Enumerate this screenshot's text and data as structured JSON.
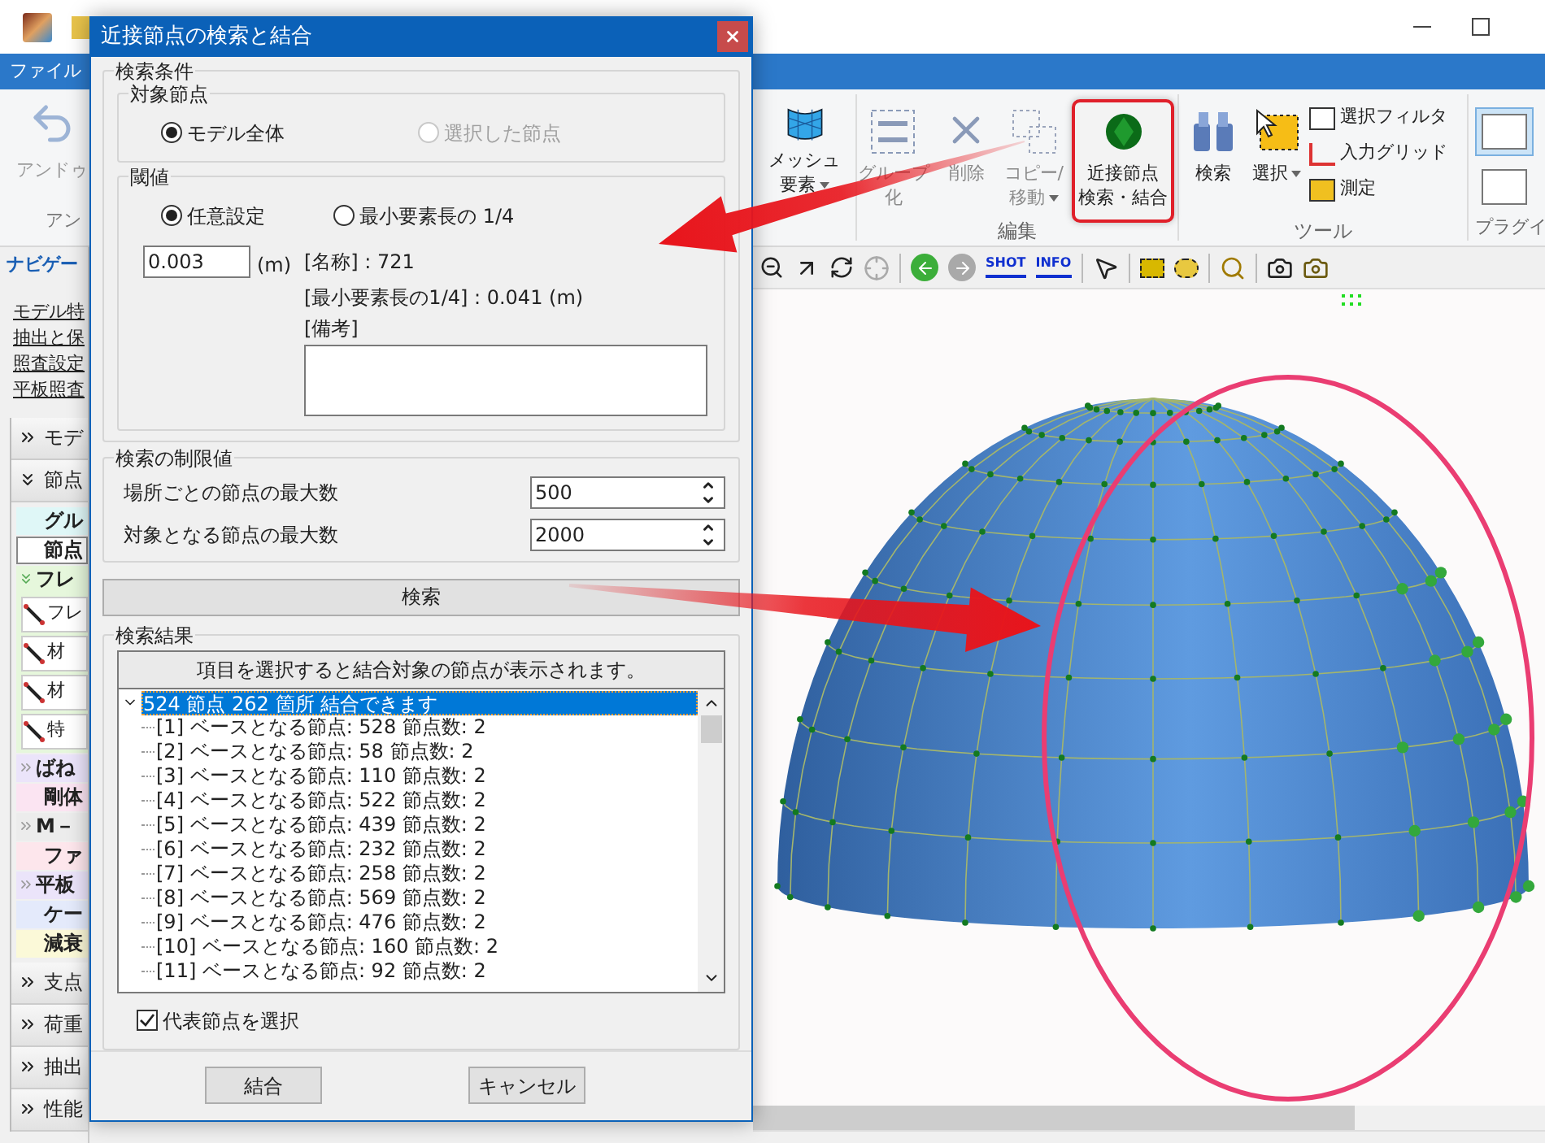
{
  "menu_tab": "ファイル",
  "ribbon": {
    "undo": {
      "label": "アンドゥ",
      "disabled": true
    },
    "undo_group": "アン",
    "mesh": {
      "lines": [
        "メッシュ",
        "要素"
      ],
      "dropdown": true,
      "disabled": false
    },
    "edit_group": {
      "label": "編集",
      "buttons": [
        {
          "lines": [
            "グループ",
            "化"
          ],
          "dropdown": false,
          "disabled": true,
          "highlighted": false
        },
        {
          "lines": [
            "削除"
          ],
          "dropdown": false,
          "disabled": true,
          "highlighted": false
        },
        {
          "lines": [
            "コピー/",
            "移動"
          ],
          "dropdown": true,
          "disabled": true,
          "highlighted": false
        },
        {
          "lines": [
            "近接節点",
            "検索・結合"
          ],
          "dropdown": false,
          "disabled": false,
          "highlighted": true
        }
      ]
    },
    "tool_group": {
      "label": "ツール",
      "buttons": [
        {
          "lines": [
            "検索"
          ],
          "dropdown": false
        },
        {
          "lines": [
            "選択"
          ],
          "dropdown": true
        }
      ],
      "small": [
        "選択フィルタ",
        "入力グリッド",
        "測定"
      ]
    },
    "plugin_group": {
      "label": "プラグイ",
      "thumbs": [
        {
          "selected": true
        },
        {
          "selected": false
        }
      ]
    }
  },
  "toolbar": {
    "shot": "SHOT",
    "info": "INFO"
  },
  "navigator": {
    "title": "ナビゲー",
    "links": [
      "モデル特",
      "抽出と保",
      "照査設定",
      "平板照査"
    ],
    "sections": [
      {
        "label": "モデ",
        "expanded": false
      },
      {
        "label": "節点",
        "expanded": true,
        "items": [
          {
            "label": "グル",
            "kind": "item",
            "color": "#dff7f7",
            "selected": false
          },
          {
            "label": "節点",
            "kind": "item",
            "color": "#ffffff",
            "selected": true
          },
          {
            "label": "フレ",
            "kind": "group",
            "color": "#e6f7dc",
            "selected": false,
            "expanded": true,
            "children": [
              {
                "label": "フレ",
                "selected": false
              },
              {
                "label": "材",
                "selected": false
              },
              {
                "label": "材",
                "selected": false
              },
              {
                "label": "特",
                "selected": false
              }
            ]
          },
          {
            "label": "ばね",
            "kind": "group",
            "color": "#ebe4fa",
            "selected": false,
            "expanded": false
          },
          {
            "label": "剛体",
            "kind": "item",
            "color": "#fbe4f2",
            "selected": false
          },
          {
            "label": "M－",
            "kind": "group",
            "color": "#ececec",
            "selected": false,
            "expanded": false
          },
          {
            "label": "ファ",
            "kind": "item",
            "color": "#fde6ec",
            "selected": false
          },
          {
            "label": "平板",
            "kind": "group",
            "color": "#ebe4fa",
            "selected": false,
            "expanded": false
          },
          {
            "label": "ケー",
            "kind": "item",
            "color": "#e4eafb",
            "selected": false
          },
          {
            "label": "減衰",
            "kind": "item",
            "color": "#fbf9d8",
            "selected": false
          }
        ]
      },
      {
        "label": "支点",
        "expanded": false
      },
      {
        "label": "荷重",
        "expanded": false
      },
      {
        "label": "抽出",
        "expanded": false
      },
      {
        "label": "性能",
        "expanded": false
      }
    ]
  },
  "dialog": {
    "title": "近接節点の検索と結合",
    "conditions": {
      "title": "検索条件",
      "target": {
        "title": "対象節点",
        "options": [
          {
            "label": "モデル全体",
            "selected": true,
            "disabled": false
          },
          {
            "label": "選択した節点",
            "selected": false,
            "disabled": true
          }
        ]
      },
      "threshold": {
        "title": "閾値",
        "options": [
          {
            "label": "任意設定",
            "selected": true
          },
          {
            "label": "最小要素長の 1/4",
            "selected": false
          }
        ],
        "value": "0.003",
        "unit": "(m)",
        "name": "[名称] : 721",
        "quarter": "[最小要素長の1/4] : 0.041 (m)",
        "note_label": "[備考]"
      }
    },
    "limits": {
      "title": "検索の制限値",
      "rows": [
        {
          "label": "場所ごとの節点の最大数",
          "value": "500"
        },
        {
          "label": "対象となる節点の最大数",
          "value": "2000"
        }
      ]
    },
    "search_button": "検索",
    "results": {
      "title": "検索結果",
      "header": "項目を選択すると結合対象の節点が表示されます。",
      "tree": [
        {
          "label": "524 節点 262 箇所 結合できます",
          "expanded": true,
          "selected": true,
          "children": [
            {
              "label": "[1] ベースとなる節点: 528 節点数: 2",
              "selected": false
            },
            {
              "label": "[2] ベースとなる節点: 58 節点数: 2",
              "selected": false
            },
            {
              "label": "[3] ベースとなる節点: 110 節点数: 2",
              "selected": false
            },
            {
              "label": "[4] ベースとなる節点: 522 節点数: 2",
              "selected": false
            },
            {
              "label": "[5] ベースとなる節点: 439 節点数: 2",
              "selected": false
            },
            {
              "label": "[6] ベースとなる節点: 232 節点数: 2",
              "selected": false
            },
            {
              "label": "[7] ベースとなる節点: 258 節点数: 2",
              "selected": false
            },
            {
              "label": "[8] ベースとなる節点: 569 節点数: 2",
              "selected": false
            },
            {
              "label": "[9] ベースとなる節点: 476 節点数: 2",
              "selected": false
            },
            {
              "label": "[10] ベースとなる節点: 160 節点数: 2",
              "selected": false
            },
            {
              "label": "[11] ベースとなる節点: 92 節点数: 2",
              "selected": false
            }
          ]
        }
      ],
      "checkbox": {
        "label": "代表節点を選択",
        "checked": true
      }
    },
    "buttons": [
      "結合",
      "キャンセル"
    ]
  }
}
